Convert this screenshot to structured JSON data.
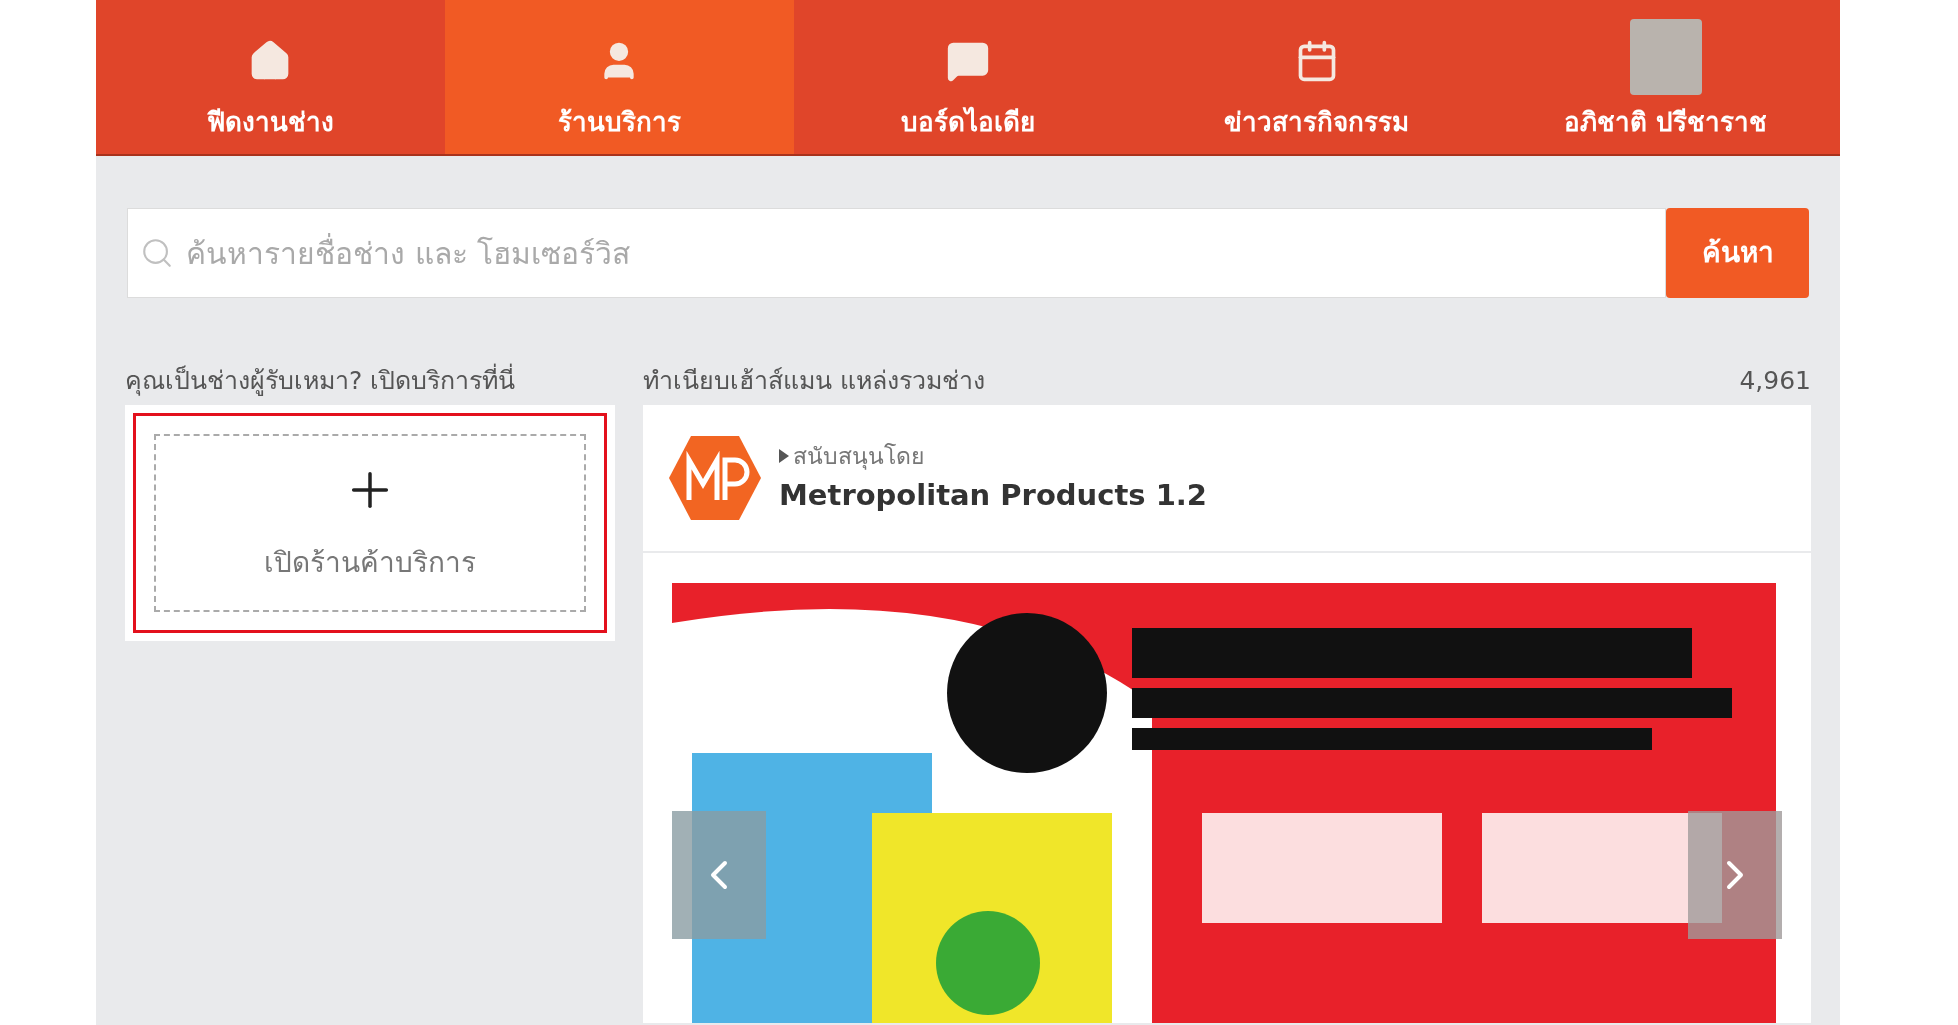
{
  "nav": [
    {
      "kind": "home",
      "label": "ฟีดงานช่าง",
      "selected": false
    },
    {
      "kind": "shop",
      "label": "ร้านบริการ",
      "selected": true
    },
    {
      "kind": "board",
      "label": "บอร์ดไอเดีย",
      "selected": false
    },
    {
      "kind": "news",
      "label": "ข่าวสารกิจกรรม",
      "selected": false
    },
    {
      "kind": "profile",
      "label": "อภิชาติ ปรีชาราช",
      "selected": false
    }
  ],
  "search": {
    "placeholder": "ค้นหารายชื่อช่าง และ โฮมเซอร์วิส",
    "button": "ค้นหา"
  },
  "left": {
    "heading": "คุณเป็นช่างผู้รับเหมา? เปิดบริการที่นี่",
    "open_shop": "เปิดร้านค้าบริการ"
  },
  "right": {
    "heading": "ทำเนียบเฮ้าส์แมน แหล่งรวมช่าง",
    "count": "4,961",
    "sponsor_label": "สนับสนุนโดย",
    "sponsor_name": "Metropolitan Products 1.2"
  }
}
